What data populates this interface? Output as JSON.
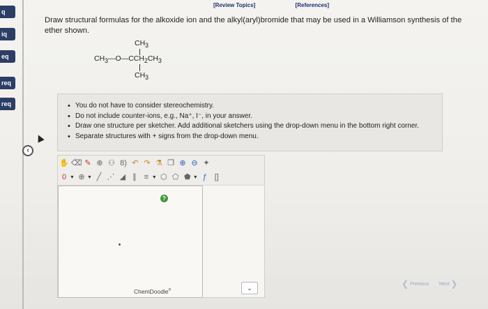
{
  "header": {
    "review_topics": "[Review Topics]",
    "references": "[References]"
  },
  "sidebar": {
    "tabs": [
      "q",
      "iq",
      "eq",
      "req",
      "req"
    ],
    "collapse_icon": "chevron-left-icon"
  },
  "question": {
    "prompt": "Draw structural formulas for the alkoxide ion and the alkyl(aryl)bromide that may be used in a Williamson synthesis of the ether shown.",
    "formula": {
      "top": "CH3",
      "left": "CH3—O—CCH2CH3",
      "bottom": "CH3"
    }
  },
  "instructions": [
    "You do not have to consider stereochemistry.",
    "Do not include counter-ions, e.g., Na⁺, I⁻, in your answer.",
    "Draw one structure per sketcher. Add additional sketchers using the drop-down menu in the bottom right corner.",
    "Separate structures with + signs from the drop-down menu."
  ],
  "sketcher": {
    "toolbar_row1": [
      "hand-icon",
      "eraser-icon",
      "pencil-icon",
      "plus-circle-icon",
      "group-icon",
      "undo-icon",
      "redo-icon",
      "template-icon",
      "copy-icon",
      "paste-icon",
      "zoom-in-icon",
      "zoom-out-icon",
      "clean-icon"
    ],
    "toolbar_row2": [
      "charge-zero",
      "charge-plus",
      "single-bond",
      "dashed-bond",
      "wedge-bond",
      "double-bond",
      "ring-hexagon",
      "ring-pentagon",
      "ring-triangle",
      "formula-icon",
      "bracket-icon"
    ],
    "charge_label": "0",
    "plus_label": "⊕",
    "help": "?",
    "brand": "ChemDoodle"
  },
  "footer": {
    "dropdown": "⌄",
    "previous": "Previous",
    "next": "Next"
  },
  "colors": {
    "accent": "#1a2e6e",
    "sidebar": "#2c3e66",
    "help_green": "#3f9a3a"
  }
}
